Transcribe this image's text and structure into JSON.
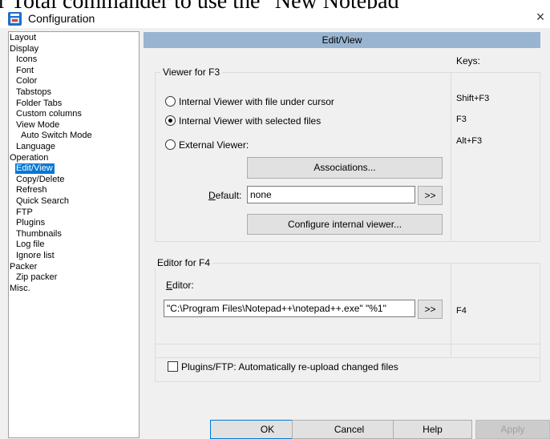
{
  "background_text": "r Total commander to use the \"New Notepad",
  "window": {
    "title": "Configuration",
    "close": "×"
  },
  "tree": [
    {
      "label": "Layout",
      "indent": 0
    },
    {
      "label": "Display",
      "indent": 0
    },
    {
      "label": "Icons",
      "indent": 1
    },
    {
      "label": "Font",
      "indent": 1
    },
    {
      "label": "Color",
      "indent": 1
    },
    {
      "label": "Tabstops",
      "indent": 1
    },
    {
      "label": "Folder Tabs",
      "indent": 1
    },
    {
      "label": "Custom columns",
      "indent": 1
    },
    {
      "label": "View Mode",
      "indent": 1
    },
    {
      "label": "Auto Switch Mode",
      "indent": 2
    },
    {
      "label": "Language",
      "indent": 1
    },
    {
      "label": "Operation",
      "indent": 0
    },
    {
      "label": "Edit/View",
      "indent": 1,
      "selected": true
    },
    {
      "label": "Copy/Delete",
      "indent": 1
    },
    {
      "label": "Refresh",
      "indent": 1
    },
    {
      "label": "Quick Search",
      "indent": 1
    },
    {
      "label": "FTP",
      "indent": 1
    },
    {
      "label": "Plugins",
      "indent": 1
    },
    {
      "label": "Thumbnails",
      "indent": 1
    },
    {
      "label": "Log file",
      "indent": 1
    },
    {
      "label": "Ignore list",
      "indent": 1
    },
    {
      "label": "Packer",
      "indent": 0
    },
    {
      "label": "Zip packer",
      "indent": 1
    },
    {
      "label": "Misc.",
      "indent": 0
    }
  ],
  "panel": {
    "header": "Edit/View",
    "keys_header": "Keys:",
    "viewer": {
      "title": "Viewer for F3",
      "options": [
        {
          "label": "Internal Viewer with file under cursor",
          "key": "Shift+F3",
          "checked": false
        },
        {
          "label": "Internal Viewer with selected files",
          "key": "F3",
          "checked": true
        },
        {
          "label": "External Viewer:",
          "key": "Alt+F3",
          "checked": false
        }
      ],
      "associations_button": "Associations...",
      "default_label_prefix": "D",
      "default_label_rest": "efault:",
      "default_value": "none",
      "browse_button": ">>",
      "configure_button": "Configure internal viewer..."
    },
    "editor": {
      "title": "Editor for F4",
      "label_prefix": "E",
      "label_rest": "ditor:",
      "value": "\"C:\\Program Files\\Notepad++\\notepad++.exe\" \"%1\"",
      "browse_button": ">>",
      "key": "F4"
    },
    "ftp_checkbox": {
      "label": "Plugins/FTP: Automatically re-upload changed files",
      "checked": false
    }
  },
  "buttons": {
    "ok": "OK",
    "cancel": "Cancel",
    "help": "Help",
    "apply": "Apply"
  }
}
